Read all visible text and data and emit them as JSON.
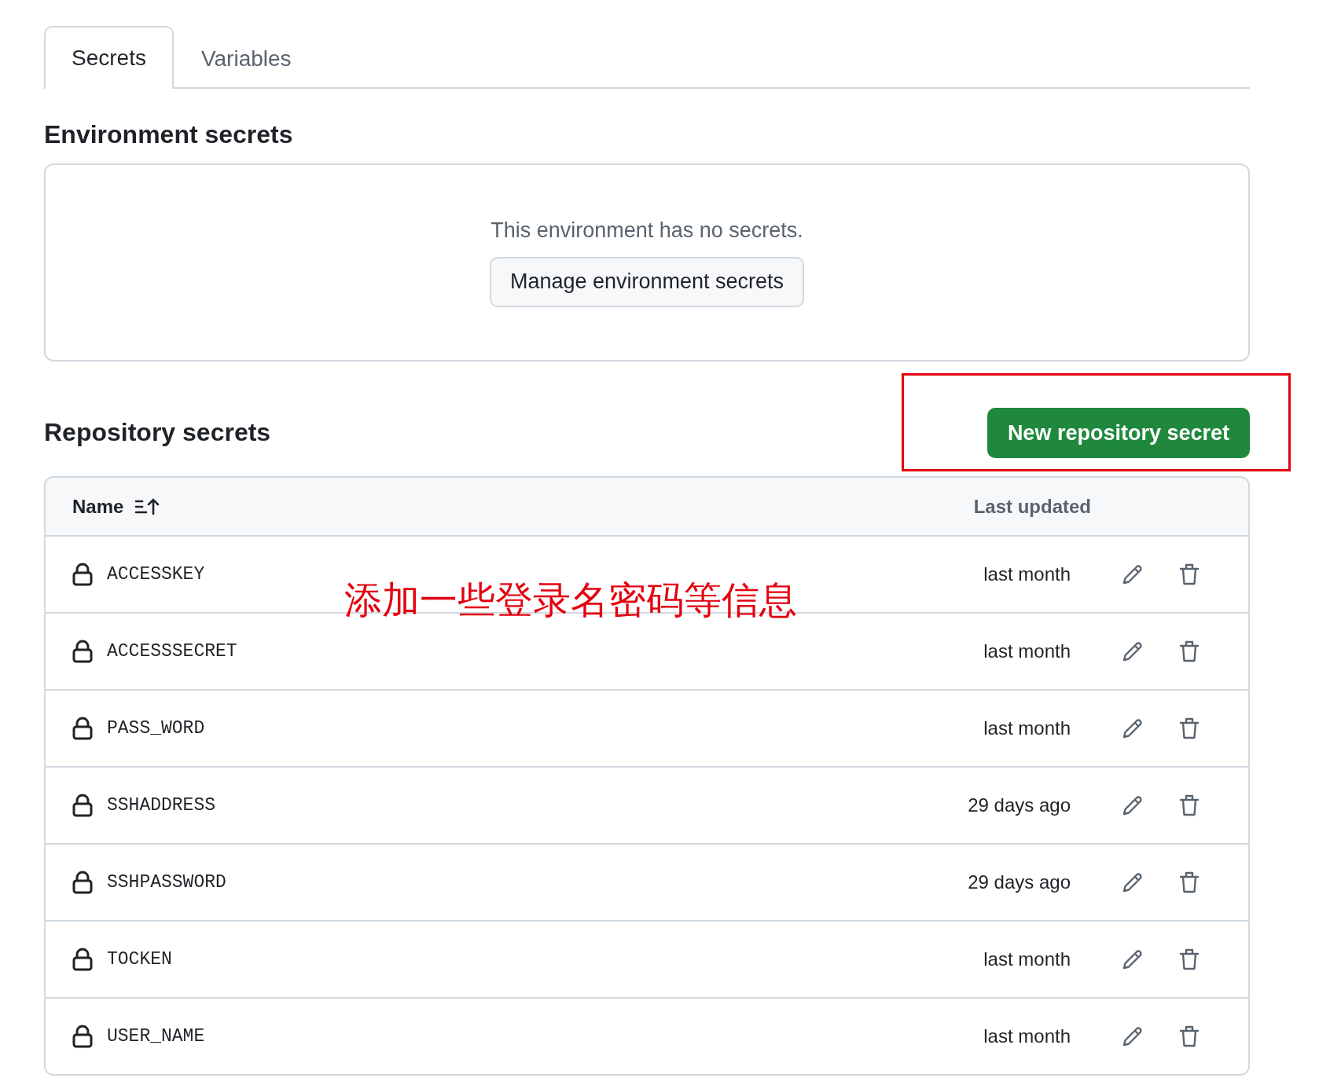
{
  "tabs": [
    {
      "label": "Secrets",
      "selected": true
    },
    {
      "label": "Variables",
      "selected": false
    }
  ],
  "environment_secrets": {
    "heading": "Environment secrets",
    "empty_message": "This environment has no secrets.",
    "button": "Manage environment secrets"
  },
  "repository_secrets": {
    "heading": "Repository secrets",
    "new_button": "New repository secret",
    "table": {
      "columns": [
        "Name",
        "Last updated"
      ],
      "rows": [
        {
          "name": "ACCESSKEY",
          "last_updated": "last month"
        },
        {
          "name": "ACCESSSECRET",
          "last_updated": "last month"
        },
        {
          "name": "PASS_WORD",
          "last_updated": "last month"
        },
        {
          "name": "SSHADDRESS",
          "last_updated": "29 days ago"
        },
        {
          "name": "SSHPASSWORD",
          "last_updated": "29 days ago"
        },
        {
          "name": "TOCKEN",
          "last_updated": "last month"
        },
        {
          "name": "USER_NAME",
          "last_updated": "last month"
        }
      ]
    }
  },
  "annotations": [
    {
      "kind": "highlight-box"
    },
    {
      "kind": "note",
      "text": "添加一些登录名密码等信息"
    }
  ]
}
